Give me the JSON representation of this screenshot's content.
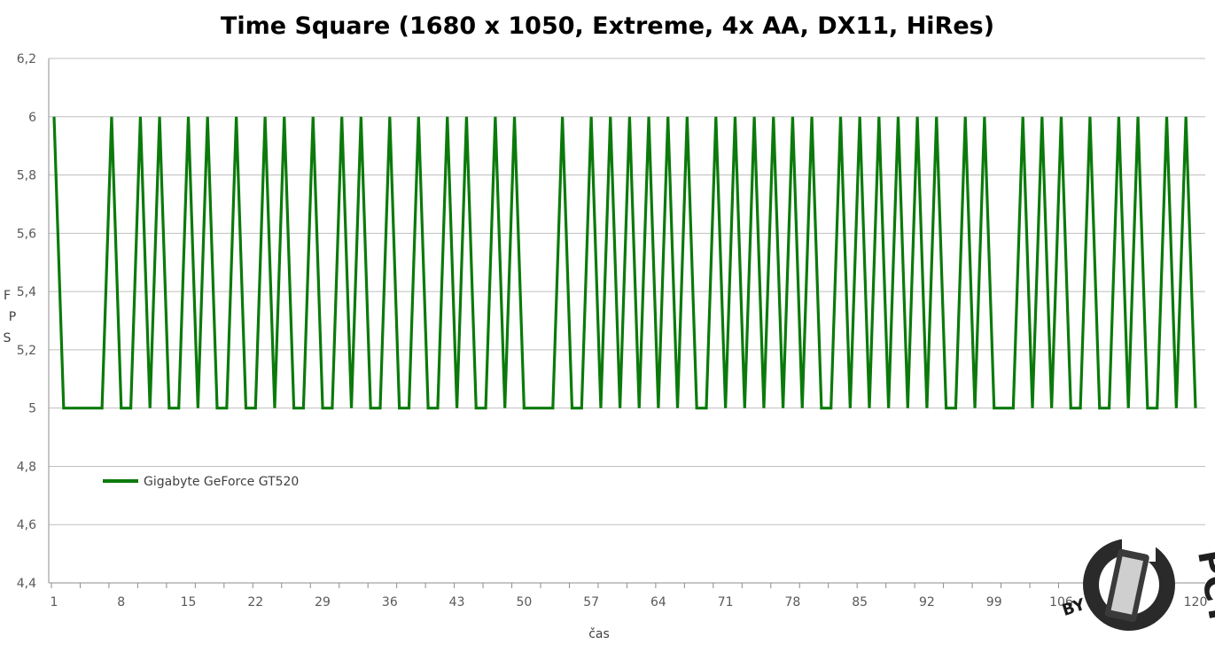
{
  "chart_data": {
    "type": "line",
    "title": "Time Square (1680 x 1050, Extreme, 4x AA, DX11, HiRes)",
    "xlabel": "čas",
    "ylabel": "FPS",
    "ylim": [
      4.4,
      6.2
    ],
    "yticks": [
      "4,4",
      "4,6",
      "4,8",
      "5",
      "5,2",
      "5,4",
      "5,6",
      "5,8",
      "6",
      "6,2"
    ],
    "xticks": [
      "1",
      "8",
      "15",
      "22",
      "29",
      "36",
      "43",
      "50",
      "57",
      "64",
      "71",
      "78",
      "85",
      "92",
      "99",
      "106",
      "120"
    ],
    "x": [
      1,
      2,
      3,
      4,
      5,
      6,
      7,
      8,
      9,
      10,
      11,
      12,
      13,
      14,
      15,
      16,
      17,
      18,
      19,
      20,
      21,
      22,
      23,
      24,
      25,
      26,
      27,
      28,
      29,
      30,
      31,
      32,
      33,
      34,
      35,
      36,
      37,
      38,
      39,
      40,
      41,
      42,
      43,
      44,
      45,
      46,
      47,
      48,
      49,
      50,
      51,
      52,
      53,
      54,
      55,
      56,
      57,
      58,
      59,
      60,
      61,
      62,
      63,
      64,
      65,
      66,
      67,
      68,
      69,
      70,
      71,
      72,
      73,
      74,
      75,
      76,
      77,
      78,
      79,
      80,
      81,
      82,
      83,
      84,
      85,
      86,
      87,
      88,
      89,
      90,
      91,
      92,
      93,
      94,
      95,
      96,
      97,
      98,
      99,
      100,
      101,
      102,
      103,
      104,
      105,
      106,
      107,
      108,
      109,
      110,
      111,
      112,
      113,
      114,
      115,
      116,
      117,
      118,
      119,
      120
    ],
    "series": [
      {
        "name": "Gigabyte GeForce GT520",
        "color": "#0b7a0b",
        "values": [
          6,
          5,
          5,
          5,
          5,
          5,
          6,
          5,
          5,
          6,
          5,
          6,
          5,
          5,
          6,
          5,
          6,
          5,
          5,
          6,
          5,
          5,
          6,
          5,
          6,
          5,
          5,
          6,
          5,
          5,
          6,
          5,
          6,
          5,
          5,
          6,
          5,
          5,
          6,
          5,
          5,
          6,
          5,
          6,
          5,
          5,
          6,
          5,
          6,
          5,
          5,
          5,
          5,
          6,
          5,
          5,
          6,
          5,
          6,
          5,
          6,
          5,
          6,
          5,
          6,
          5,
          6,
          5,
          5,
          6,
          5,
          6,
          5,
          6,
          5,
          6,
          5,
          6,
          5,
          6,
          5,
          5,
          6,
          5,
          6,
          5,
          6,
          5,
          6,
          5,
          6,
          5,
          6,
          5,
          5,
          6,
          5,
          6,
          5,
          5,
          5,
          6,
          5,
          6,
          5,
          6,
          5,
          5,
          6,
          5,
          5,
          6,
          5,
          6,
          5,
          5,
          6,
          5,
          6,
          5
        ]
      }
    ],
    "grid": true,
    "legend_position": "inside-left"
  },
  "watermark": {
    "text": "BY PCTUNING"
  }
}
